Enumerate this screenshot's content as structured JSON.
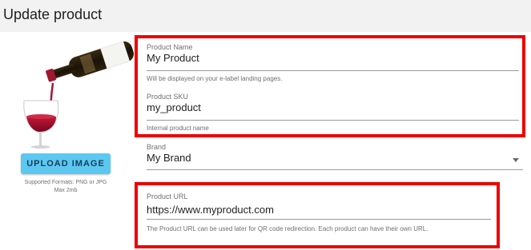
{
  "header": {
    "title": "Update product"
  },
  "image": {
    "upload_label": "UPLOAD IMAGE",
    "formats_line1": "Supported Formats: PNG or JPG",
    "formats_line2": "Max 2mb"
  },
  "form": {
    "product_name": {
      "label": "Product Name",
      "value": "My Product",
      "helper": "Will be displayed on your e-label landing pages."
    },
    "product_sku": {
      "label": "Product SKU",
      "value": "my_product",
      "helper": "Internal product name"
    },
    "brand": {
      "label": "Brand",
      "value": "My Brand"
    },
    "product_url": {
      "label": "Product URL",
      "value": "https://www.myproduct.com",
      "helper": "The Product URL can be used later for QR code redirection. Each product can have their own URL."
    }
  },
  "colors": {
    "accent_button": "#5cc8f2",
    "highlight": "#ee0000",
    "header_bg": "#f2f2f2"
  }
}
